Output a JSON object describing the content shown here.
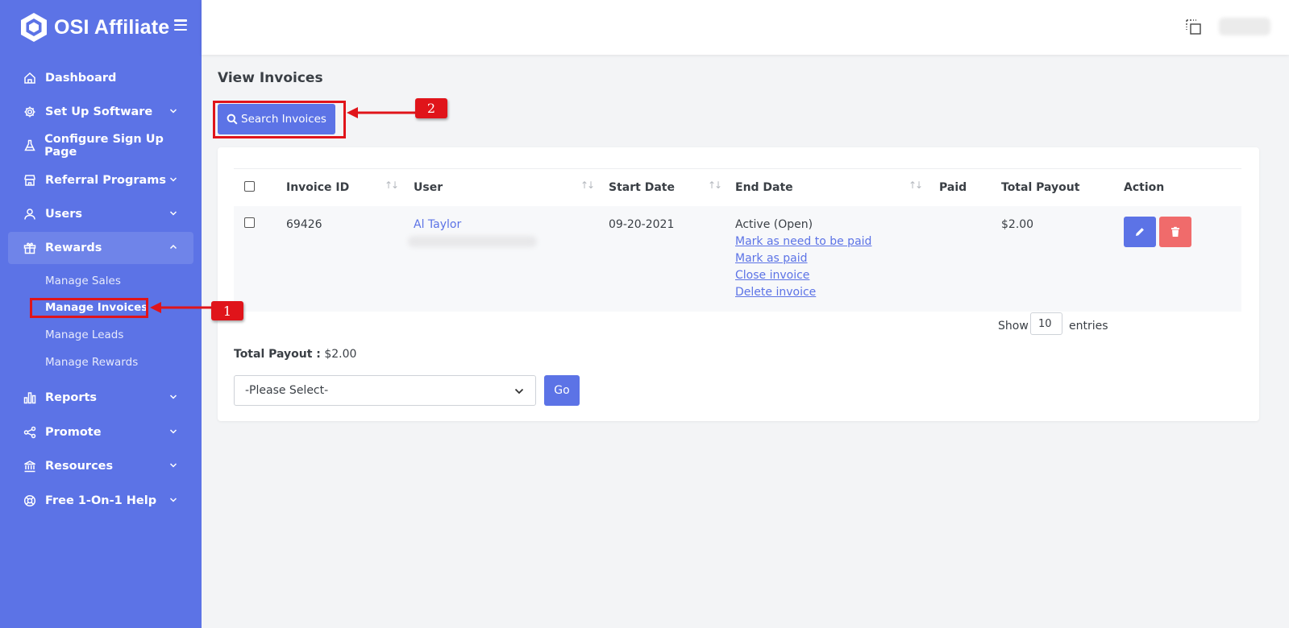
{
  "app": {
    "brand": "OSI Affiliate",
    "colors": {
      "primary": "#5c73e6",
      "danger": "#f06b6b",
      "annotation": "#e0141a"
    }
  },
  "sidebar": {
    "items": [
      {
        "label": "Dashboard",
        "icon": "home-icon",
        "expandable": false
      },
      {
        "label": "Set Up Software",
        "icon": "gear-icon",
        "expandable": true
      },
      {
        "label": "Configure Sign Up Page",
        "icon": "flask-icon",
        "expandable": false
      },
      {
        "label": "Referral Programs",
        "icon": "store-icon",
        "expandable": true
      },
      {
        "label": "Users",
        "icon": "user-icon",
        "expandable": true
      },
      {
        "label": "Rewards",
        "icon": "gift-icon",
        "expandable": true,
        "expanded": true
      },
      {
        "label": "Reports",
        "icon": "bar-chart-icon",
        "expandable": true
      },
      {
        "label": "Promote",
        "icon": "share-icon",
        "expandable": true
      },
      {
        "label": "Resources",
        "icon": "bank-icon",
        "expandable": true
      },
      {
        "label": "Free 1-On-1 Help",
        "icon": "lifebuoy-icon",
        "expandable": true
      }
    ],
    "rewards_sub": [
      "Manage Sales",
      "Manage Invoices",
      "Manage Leads",
      "Manage Rewards"
    ],
    "current_sub": "Manage Invoices"
  },
  "page": {
    "title": "View Invoices",
    "search_button": "Search Invoices"
  },
  "table": {
    "columns": [
      "Invoice ID",
      "User",
      "Start Date",
      "End Date",
      "Paid",
      "Total Payout",
      "Action"
    ],
    "rows": [
      {
        "invoice_id": "69426",
        "user": "Al Taylor",
        "start_date": "09-20-2021",
        "end_date_status": "Active (Open)",
        "links": [
          "Mark as need to be paid",
          "Mark as paid",
          "Close invoice",
          "Delete invoice"
        ],
        "paid": "",
        "total_payout": "$2.00"
      }
    ]
  },
  "entries": {
    "show_label": "Show",
    "value": "10",
    "suffix": "entries"
  },
  "summary": {
    "total_label": "Total Payout :",
    "total_value": "$2.00"
  },
  "bulk": {
    "select_value": "-Please Select-",
    "go_label": "Go"
  },
  "annotations": [
    "1",
    "2"
  ]
}
